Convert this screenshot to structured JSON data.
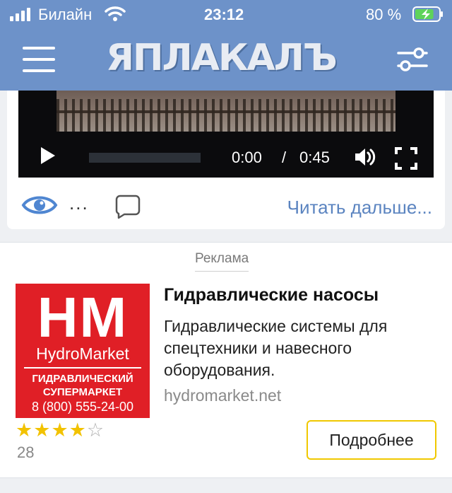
{
  "status_bar": {
    "carrier": "Билайн",
    "time": "23:12",
    "battery_percent": "80 %",
    "battery_level": 0.8
  },
  "header": {
    "logo_text": "ЯПЛАКАЛЪ",
    "accent_color": "#6d92c9"
  },
  "video": {
    "current_time": "0:00",
    "separator": "/",
    "duration": "0:45",
    "progress": 0
  },
  "post_meta": {
    "views": "...",
    "read_more": "Читать дальше..."
  },
  "ad": {
    "label": "Реклама",
    "image": {
      "letters": "HM",
      "brand": "HydroMarket",
      "subtitle_line1": "ГИДРАВЛИЧЕСКИЙ",
      "subtitle_line2": "СУПЕРМАРКЕТ",
      "phone": "8 (800) 555-24-00"
    },
    "rating_stars": 4,
    "rating_max": 5,
    "rating_count": "28",
    "title": "Гидравлические насосы",
    "description": "Гидравлические системы для спецтехники и навесного оборудования.",
    "domain": "hydromarket.net",
    "button_label": "Подробнее"
  }
}
